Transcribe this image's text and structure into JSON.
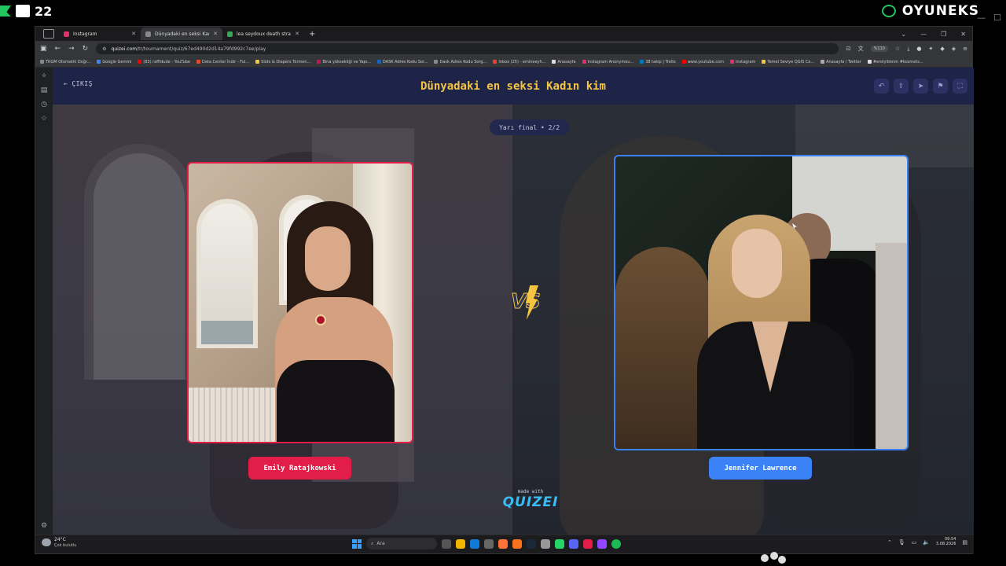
{
  "stream": {
    "left_number": "22",
    "brand": "OYUNEKS"
  },
  "browser": {
    "tabs": [
      {
        "title": "Instagram",
        "color": "#e1306c",
        "active": false
      },
      {
        "title": "Dünyadaki en seksi Kadın kim",
        "color": "#888888",
        "active": true
      },
      {
        "title": "lea seydoux death stranding fe...",
        "color": "#34a853",
        "active": false
      }
    ],
    "url_host": "quizei.com",
    "url_path": "/tr/tournament/quiz/67ed490d2d14a79fd992c7ee/play",
    "zoom": "%110",
    "bookmarks": [
      {
        "label": "TKGM Otomatik Doğr...",
        "color": "#888888"
      },
      {
        "label": "Google Gemini",
        "color": "#4285f4"
      },
      {
        "label": "(83) raffidude - YouTube",
        "color": "#ff0000"
      },
      {
        "label": "Data Center İndir - Ful...",
        "color": "#e34c26"
      },
      {
        "label": "Slots & Diapers Tormen...",
        "color": "#f5c542"
      },
      {
        "label": "Bina yüksekliği ve Yapı...",
        "color": "#c2185b"
      },
      {
        "label": "DASK Adres Kodu Sor...",
        "color": "#1565c0"
      },
      {
        "label": "Dask Adres Kodu Sorg...",
        "color": "#888888"
      },
      {
        "label": "Inbox (25) - emineeyh...",
        "color": "#ea4335"
      },
      {
        "label": "Anasayfa",
        "color": "#dddddd"
      },
      {
        "label": "Instagram Anonymou...",
        "color": "#e1306c"
      },
      {
        "label": "38 takip | Trello",
        "color": "#0079bf"
      },
      {
        "label": "www.youtube.com",
        "color": "#ff0000"
      },
      {
        "label": "Instagram",
        "color": "#e1306c"
      },
      {
        "label": "Temel Seviye QGIS Co...",
        "color": "#f5c542"
      },
      {
        "label": "Anasayfa / Twitter",
        "color": "#aaaaaa"
      },
      {
        "label": "#erolyildırım #kozmets...",
        "color": "#dddddd"
      }
    ]
  },
  "quiz": {
    "exit_label": "ÇIKIŞ",
    "title": "Dünyadaki en seksi Kadın kim",
    "round": "Yarı final • 2/2",
    "vs_label": "VS",
    "left_name": "Emily Ratajkowski",
    "right_name": "Jennifer Lawrence",
    "made_with": "made with",
    "brand": "QUIZEI",
    "colors": {
      "accent": "#f5c542",
      "left": "#e11d48",
      "right": "#3b82f6",
      "header_bg": "#1e2448"
    }
  },
  "taskbar": {
    "temperature": "24°C",
    "condition": "Çok bulutlu",
    "search_placeholder": "Ara",
    "time": "09:54",
    "date": "3.08.2026"
  }
}
